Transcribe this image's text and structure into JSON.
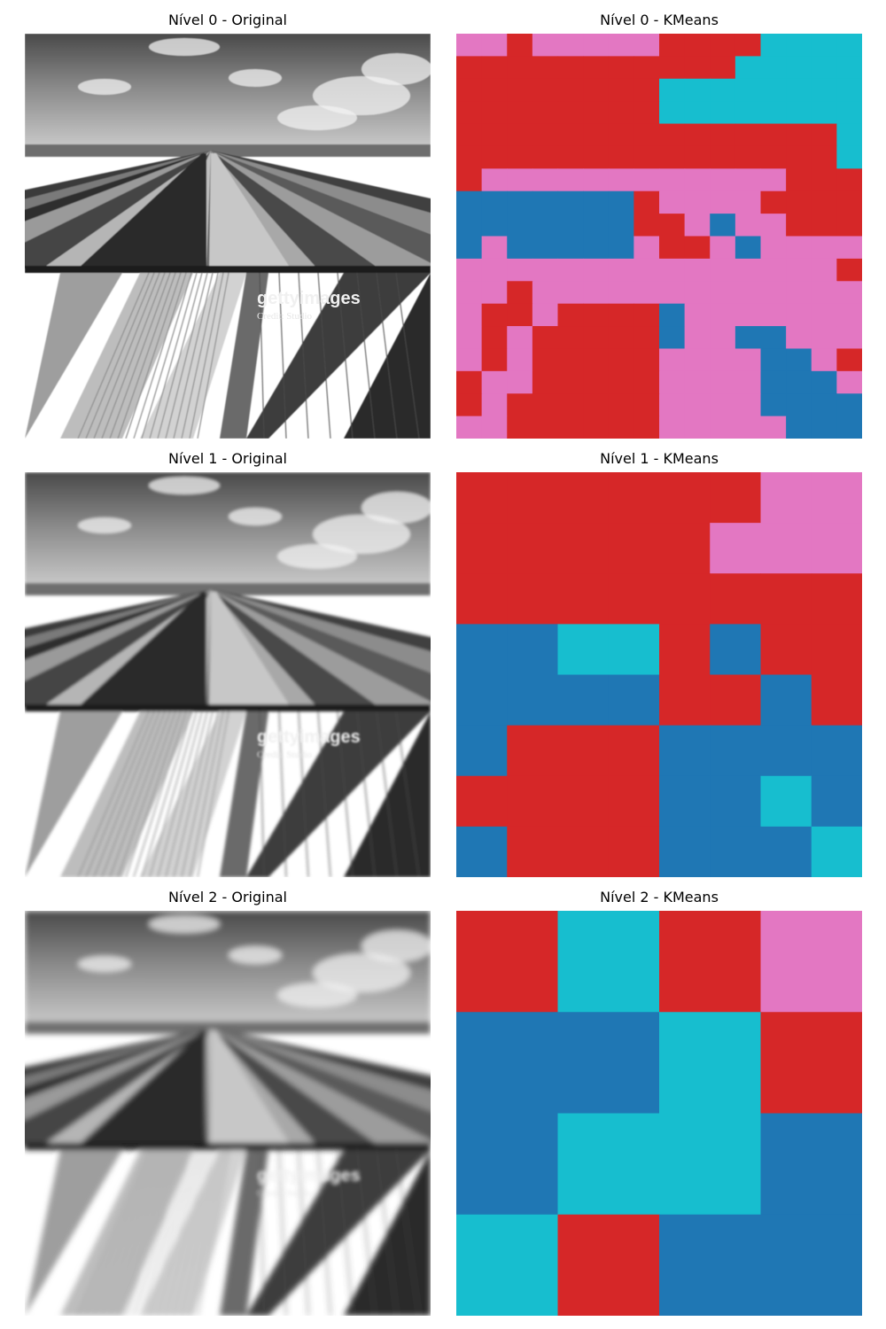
{
  "panels": [
    {
      "title": "Nível 0 - Original"
    },
    {
      "title": "Nível 0 - KMeans"
    },
    {
      "title": "Nível 1 - Original"
    },
    {
      "title": "Nível 1 - KMeans"
    },
    {
      "title": "Nível 2 - Original"
    },
    {
      "title": "Nível 2 - KMeans"
    }
  ],
  "photo": {
    "watermark_brand": "gettyimages",
    "watermark_credit": "Credit: Studio"
  },
  "palette": {
    "blue": "#1f77b4",
    "red": "#d62728",
    "pink": "#e377c2",
    "cyan": "#17becf"
  },
  "kmeans_grids": {
    "level0": [
      "PPRPPPPPRRRRCCCC",
      "RRRRRRRRRRRCCCCC",
      "RRRRRRRRCCCCCCCC",
      "RRRRRRRRCCCCCCCC",
      "RRRRRRRRRRRRRRRC",
      "RRRRRRRRRRRRRRRC",
      "RPPPPPPPPPPPPRRR",
      "BBBBBBBRPPPPRRRR",
      "BBBBBBBRRPBPPRRR",
      "BPBBBBBPRRPBPPPP",
      "PPPPPPPPPPPPPPPR",
      "PPRPPPPPPPPPPPPP",
      "PRRPRRRRBPPPPPPP",
      "PRPRRRRRBPPBBPPP",
      "PRPRRRRRPPPPBBPR",
      "RPPRRRRRPPPPBBBP",
      "RPRRRRRRPPPPBBBB",
      "PPRRRRRRPPPPPBBB"
    ],
    "level1": [
      "RRRRRRPP",
      "RRRRRPPP",
      "RRRRRRRR",
      "BBCCRBRR",
      "BBBBRRBR",
      "BRRRBBBB",
      "RRRRBBCB",
      "BRRRBBBC"
    ],
    "level2": [
      "RCRP",
      "BBCR",
      "BCCB",
      "CRBB"
    ]
  }
}
